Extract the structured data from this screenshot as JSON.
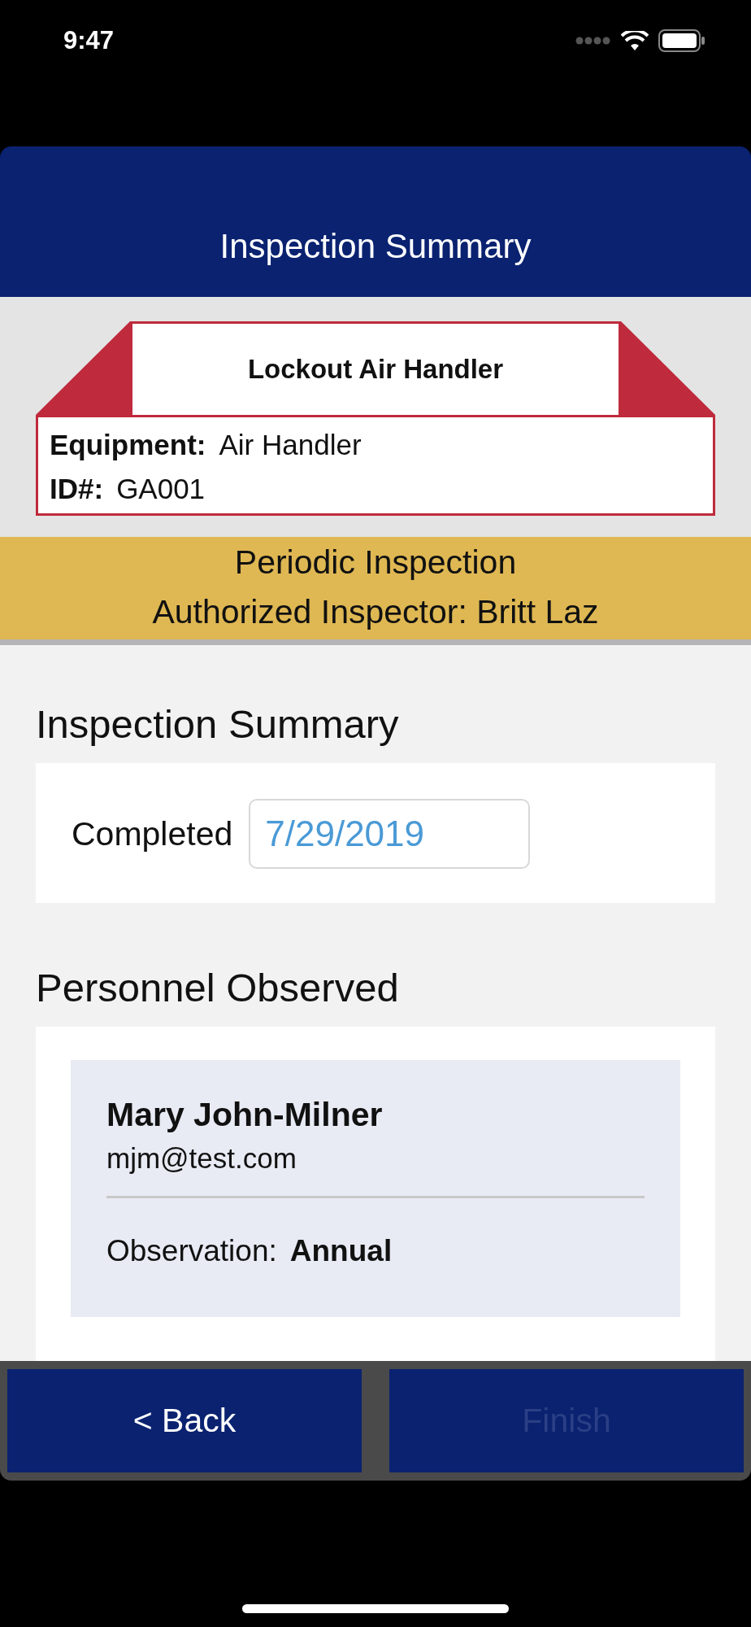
{
  "status_bar": {
    "time": "9:47"
  },
  "header": {
    "title": "Inspection Summary"
  },
  "tag": {
    "title": "Lockout Air Handler",
    "fields": [
      {
        "label": "Equipment:",
        "value": "Air Handler"
      },
      {
        "label": "ID#:",
        "value": "GA001"
      }
    ]
  },
  "banner": {
    "type": "Periodic Inspection",
    "inspector": "Authorized Inspector: Britt Laz"
  },
  "summary": {
    "heading": "Inspection Summary",
    "completed_label": "Completed",
    "completed_value": "7/29/2019"
  },
  "personnel": {
    "heading": "Personnel Observed",
    "people": [
      {
        "name": "Mary John-Milner",
        "email": "mjm@test.com",
        "details": [
          {
            "label": "Observation:",
            "value": "Annual"
          }
        ]
      }
    ]
  },
  "buttons": [
    {
      "label": "< Back",
      "disabled": false
    },
    {
      "label": "Finish",
      "disabled": true
    }
  ]
}
